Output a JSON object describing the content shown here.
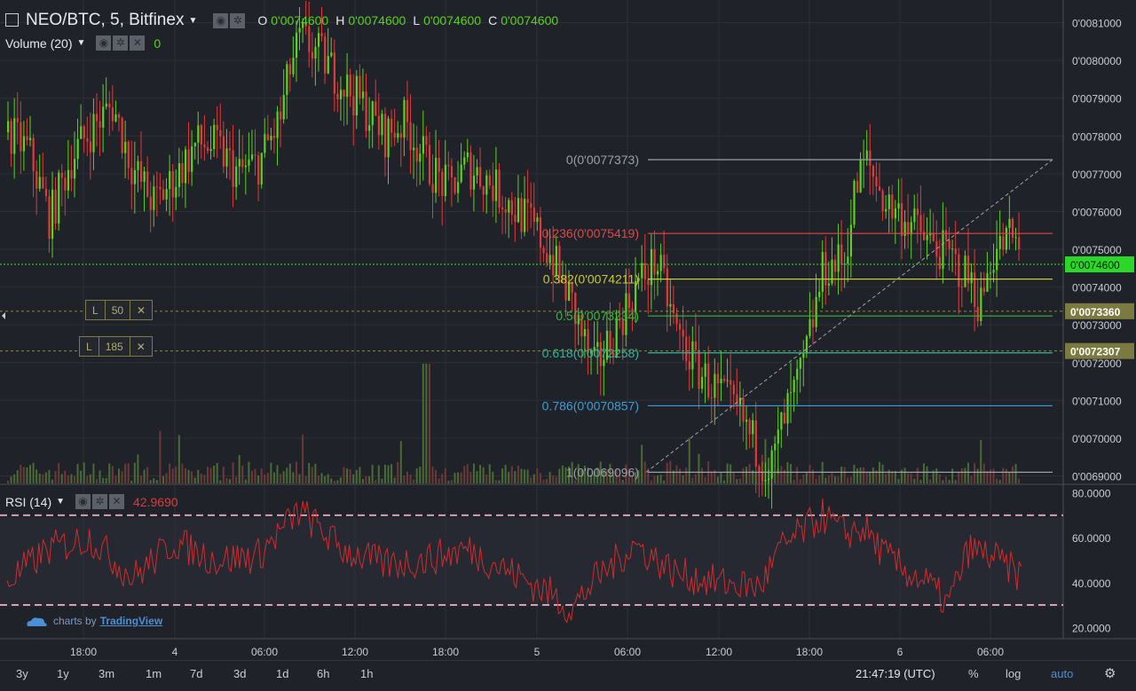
{
  "header": {
    "symbol": "NEO/BTC, 5, Bitfinex",
    "ohlc": [
      {
        "key": "O",
        "value": "0'0074600"
      },
      {
        "key": "H",
        "value": "0'0074600"
      },
      {
        "key": "L",
        "value": "0'0074600"
      },
      {
        "key": "C",
        "value": "0'0074600"
      }
    ]
  },
  "volume_study": {
    "label": "Volume (20)",
    "value": "0"
  },
  "rsi_study": {
    "label": "RSI (14)",
    "value": "42.9690"
  },
  "orders": [
    {
      "side": "L",
      "qty": "50",
      "close": "✕"
    },
    {
      "side": "L",
      "qty": "185",
      "close": "✕"
    }
  ],
  "branding": {
    "prefix": "charts by",
    "name": "TradingView"
  },
  "timeframes": [
    "3y",
    "1y",
    "3m",
    "1m",
    "7d",
    "3d",
    "1d",
    "6h",
    "1h"
  ],
  "footer": {
    "clock": "21:47:19 (UTC)",
    "percent": "%",
    "log": "log",
    "auto": "auto"
  },
  "colors": {
    "up": "#5bd21d",
    "down": "#e03a3a",
    "background": "#1f2228",
    "grid": "#2c3037",
    "rsi": "#d02c2c",
    "current_price": "#3ee02b",
    "order_line": "#8a8a4a"
  },
  "chart_data": [
    {
      "type": "candlestick",
      "series": [
        {
          "name": "NEO/BTC, 5, Bitfinex"
        }
      ],
      "x_ticks": [
        "18:00",
        "4",
        "06:00",
        "12:00",
        "18:00",
        "5",
        "06:00",
        "12:00",
        "18:00",
        "6",
        "06:00"
      ],
      "y_ticks": [
        "0'0081000",
        "0'0080000",
        "0'0079000",
        "0'0078000",
        "0'0077000",
        "0'0076000",
        "0'0075000",
        "0'0074000",
        "0'0073000",
        "0'0072000",
        "0'0071000",
        "0'0070000",
        "0'0069000"
      ],
      "ylim": [
        0.00688,
        0.00816
      ],
      "current_price": {
        "value": 0.00746,
        "label": "0'0074600"
      },
      "order_lines": [
        {
          "value": 0.007336,
          "label": "0'0073360"
        },
        {
          "value": 0.0072307,
          "label": "0'0072307"
        }
      ],
      "fibonacci": [
        {
          "label": "0(0'0077373)",
          "value": 0.0077373,
          "color": "#9aa0a8"
        },
        {
          "label": "0.236(0'0075419)",
          "value": 0.0075419,
          "color": "#e04848"
        },
        {
          "label": "0.382(0'0074211)",
          "value": 0.0074211,
          "color": "#c8c83a"
        },
        {
          "label": "0.5(0'0073234)",
          "value": 0.0073234,
          "color": "#38b63a"
        },
        {
          "label": "0.618(0'0072258)",
          "value": 0.0072258,
          "color": "#2fb89a"
        },
        {
          "label": "0.786(0'0070857)",
          "value": 0.0070857,
          "color": "#3b9ed8"
        },
        {
          "label": "1(0'0069096)",
          "value": 0.0069096,
          "color": "#9aa0a8"
        }
      ],
      "trend_line": {
        "from": {
          "x": "5 07:00",
          "y": 0.0069096
        },
        "to": {
          "x": "5 22:20",
          "y": 0.0077373
        }
      },
      "price_path": [
        [
          0,
          0.00781
        ],
        [
          2,
          0.00776
        ],
        [
          4,
          0.00758
        ],
        [
          6,
          0.00774
        ],
        [
          8,
          0.00782
        ],
        [
          10,
          0.00788
        ],
        [
          12,
          0.00771
        ],
        [
          14,
          0.00762
        ],
        [
          16,
          0.00769
        ],
        [
          18,
          0.00778
        ],
        [
          20,
          0.00777
        ],
        [
          22,
          0.0077
        ],
        [
          24,
          0.00773
        ],
        [
          26,
          0.00784
        ],
        [
          27,
          0.00798
        ],
        [
          28,
          0.00806
        ],
        [
          30,
          0.00801
        ],
        [
          32,
          0.00794
        ],
        [
          34,
          0.00788
        ],
        [
          36,
          0.0078
        ],
        [
          38,
          0.00784
        ],
        [
          40,
          0.00773
        ],
        [
          42,
          0.00766
        ],
        [
          44,
          0.00772
        ],
        [
          46,
          0.00768
        ],
        [
          48,
          0.00762
        ],
        [
          50,
          0.00757
        ],
        [
          52,
          0.00748
        ],
        [
          54,
          0.00735
        ],
        [
          56,
          0.00718
        ],
        [
          58,
          0.00728
        ],
        [
          60,
          0.0074
        ],
        [
          62,
          0.00747
        ],
        [
          64,
          0.00728
        ],
        [
          66,
          0.00718
        ],
        [
          68,
          0.00712
        ],
        [
          70,
          0.00706
        ],
        [
          72,
          0.00695
        ],
        [
          73,
          0.00692
        ],
        [
          74,
          0.00703
        ],
        [
          76,
          0.00718
        ],
        [
          78,
          0.00745
        ],
        [
          80,
          0.00747
        ],
        [
          81,
          0.00765
        ],
        [
          82,
          0.00774
        ],
        [
          84,
          0.00762
        ],
        [
          86,
          0.00758
        ],
        [
          88,
          0.00752
        ],
        [
          90,
          0.00748
        ],
        [
          92,
          0.00742
        ],
        [
          93,
          0.00735
        ],
        [
          94,
          0.00748
        ],
        [
          96,
          0.00754
        ],
        [
          97,
          0.00746
        ]
      ]
    },
    {
      "type": "line",
      "series": [
        {
          "name": "RSI (14)"
        }
      ],
      "y_ticks": [
        "80.0000",
        "60.0000",
        "40.0000",
        "20.0000"
      ],
      "ylim": [
        15,
        83
      ],
      "bands": [
        70,
        30
      ],
      "rsi_path": [
        [
          0,
          40
        ],
        [
          4,
          55
        ],
        [
          8,
          60
        ],
        [
          12,
          42
        ],
        [
          16,
          58
        ],
        [
          20,
          50
        ],
        [
          24,
          52
        ],
        [
          28,
          72
        ],
        [
          32,
          55
        ],
        [
          36,
          48
        ],
        [
          40,
          50
        ],
        [
          44,
          55
        ],
        [
          48,
          45
        ],
        [
          52,
          35
        ],
        [
          54,
          28
        ],
        [
          56,
          40
        ],
        [
          60,
          57
        ],
        [
          64,
          44
        ],
        [
          68,
          40
        ],
        [
          72,
          38
        ],
        [
          74,
          55
        ],
        [
          78,
          70
        ],
        [
          80,
          62
        ],
        [
          82,
          64
        ],
        [
          84,
          52
        ],
        [
          86,
          45
        ],
        [
          88,
          40
        ],
        [
          90,
          30
        ],
        [
          92,
          55
        ],
        [
          94,
          52
        ],
        [
          97,
          43
        ]
      ]
    }
  ]
}
